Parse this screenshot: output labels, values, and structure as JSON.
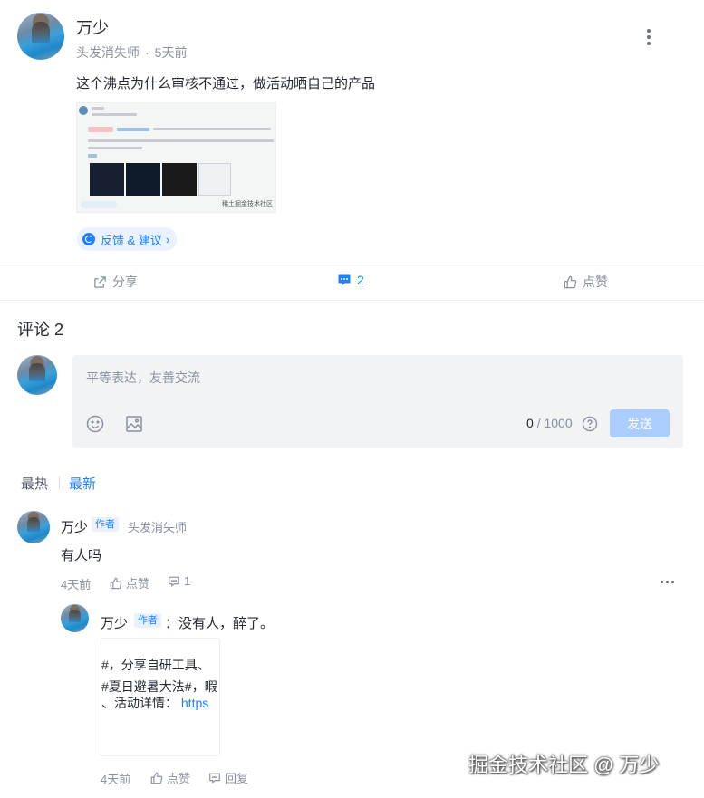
{
  "post": {
    "author": "万少",
    "author_title": "头发消失师",
    "time": "5天前",
    "text": "这个沸点为什么审核不通过，做活动晒自己的产品",
    "feedback_label": "反馈 & 建议",
    "feedback_chevron": "›"
  },
  "actions": {
    "share": "分享",
    "comment_count": "2",
    "like": "点赞"
  },
  "comments_section": {
    "title": "评论 2",
    "editor_placeholder": "平等表达，友善交流",
    "char_count": "0",
    "char_limit": "/ 1000",
    "send_label": "发送",
    "sort_hot": "最热",
    "sort_new": "最新"
  },
  "comments": [
    {
      "author": "万少",
      "badge": "作者",
      "author_title": "头发消失师",
      "text": "有人吗",
      "time": "4天前",
      "like": "点赞",
      "reply_count": "1"
    }
  ],
  "reply": {
    "author": "万少",
    "badge": "作者",
    "text": "：没有人，醉了。",
    "image_lines": [
      "#，分享自研工具、",
      "#夏日避暑大法#，暇",
      "、活动详情："
    ],
    "image_link": "https",
    "time": "4天前",
    "like": "点赞",
    "reply": "回复"
  },
  "watermark": "掘金技术社区 @ 万少",
  "colors": {
    "accent": "#1e80ff",
    "muted": "#8a919f",
    "editor_bg": "#f2f3f5",
    "send_disabled": "#abcdff"
  }
}
